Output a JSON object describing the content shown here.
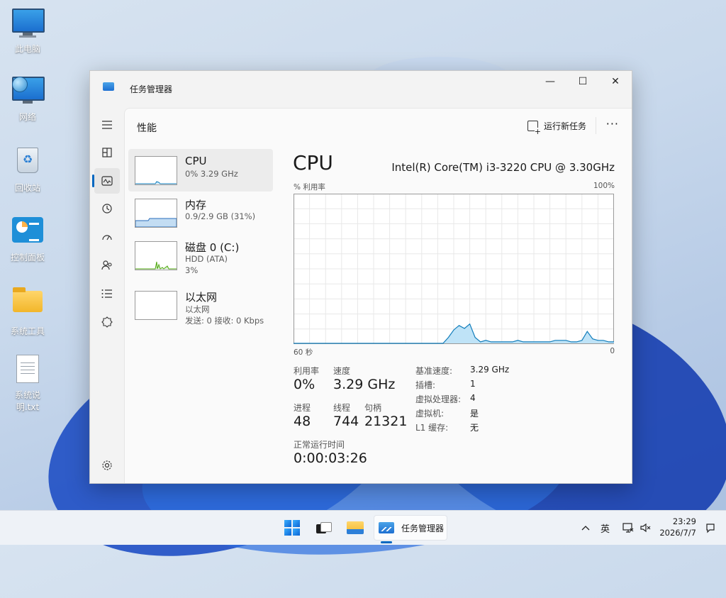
{
  "desktop": {
    "icons": [
      {
        "label": "此电脑"
      },
      {
        "label": "网络"
      },
      {
        "label": "回收站"
      },
      {
        "label": "控制面板"
      },
      {
        "label": "系统工具"
      },
      {
        "label": "系统说明.txt"
      }
    ]
  },
  "window": {
    "title": "任务管理器",
    "controls": {
      "minimize": "—",
      "maximize": "☐",
      "close": "✕"
    }
  },
  "rail": {
    "icons": [
      "hamburger-menu-icon",
      "processes-icon",
      "performance-icon",
      "app-history-icon",
      "startup-apps-icon",
      "users-icon",
      "details-icon",
      "services-icon",
      "settings-icon"
    ]
  },
  "header": {
    "page_title": "性能",
    "run_task_label": "运行新任务",
    "more_label": "···"
  },
  "perf_list": [
    {
      "name": "CPU",
      "sub": "0% 3.29 GHz",
      "sub2": ""
    },
    {
      "name": "内存",
      "sub": "0.9/2.9 GB (31%)",
      "sub2": ""
    },
    {
      "name": "磁盘 0 (C:)",
      "sub": "HDD (ATA)",
      "sub2": "3%"
    },
    {
      "name": "以太网",
      "sub": "以太网",
      "sub2": "发送: 0 接收: 0 Kbps"
    }
  ],
  "cpu": {
    "heading": "CPU",
    "model": "Intel(R) Core(TM) i3-3220 CPU @ 3.30GHz",
    "y_label": "% 利用率",
    "y_max_label": "100%",
    "x_left_label": "60 秒",
    "x_right_label": "0",
    "stats": {
      "util_label": "利用率",
      "util_value": "0%",
      "speed_label": "速度",
      "speed_value": "3.29 GHz",
      "proc_label": "进程",
      "proc_value": "48",
      "threads_label": "线程",
      "threads_value": "744",
      "handles_label": "句柄",
      "handles_value": "21321",
      "uptime_label": "正常运行时间",
      "uptime_value": "0:00:03:26"
    },
    "info": [
      {
        "k": "基准速度:",
        "v": "3.29 GHz"
      },
      {
        "k": "插槽:",
        "v": "1"
      },
      {
        "k": "虚拟处理器:",
        "v": "4"
      },
      {
        "k": "虚拟机:",
        "v": "是"
      },
      {
        "k": "L1 缓存:",
        "v": "无"
      }
    ]
  },
  "chart_data": {
    "type": "area",
    "xlabel": "",
    "ylabel": "% 利用率",
    "x_range_labels": [
      "60 秒",
      "0"
    ],
    "ylim": [
      0,
      100
    ],
    "grid": true,
    "series": [
      {
        "values": [
          0,
          0,
          0,
          0,
          0,
          0,
          0,
          0,
          0,
          0,
          0,
          0,
          0,
          0,
          0,
          0,
          0,
          0,
          0,
          0,
          0,
          0,
          0,
          0,
          0,
          0,
          0,
          0,
          0,
          4,
          9,
          12,
          10,
          13,
          4,
          1,
          2,
          1,
          1,
          1,
          1,
          1,
          2,
          1,
          1,
          1,
          1,
          1,
          1,
          2,
          2,
          2,
          1,
          1,
          2,
          8,
          3,
          2,
          2,
          1,
          1
        ]
      }
    ],
    "color": "#117dbb",
    "fill": "#bfe3f7"
  },
  "taskbar": {
    "tm_label": "任务管理器",
    "tray_chevron": "^",
    "ime": "英",
    "time": "23:29",
    "date": "2026/7/7"
  }
}
